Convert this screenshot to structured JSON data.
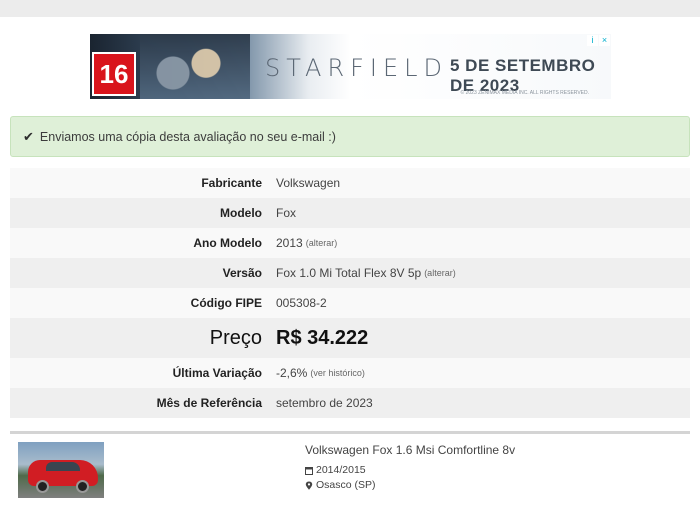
{
  "ad": {
    "rating": "16",
    "logo": "STARFIELD",
    "date": "5 DE SETEMBRO DE 2023",
    "copyright": "© 2023 ZENIMAX MEDIA INC. ALL RIGHTS RESERVED.",
    "info_icon": "i",
    "close_icon": "×"
  },
  "alert": {
    "message": "Enviamos uma cópia desta avaliação no seu e-mail :)"
  },
  "details": {
    "fabricante": {
      "label": "Fabricante",
      "value": "Volkswagen"
    },
    "modelo": {
      "label": "Modelo",
      "value": "Fox"
    },
    "ano_modelo": {
      "label": "Ano Modelo",
      "value": "2013",
      "action": "(alterar)"
    },
    "versao": {
      "label": "Versão",
      "value": "Fox 1.0 Mi Total Flex 8V 5p",
      "action": "(alterar)"
    },
    "codigo_fipe": {
      "label": "Código FIPE",
      "value": "005308-2"
    },
    "preco": {
      "label": "Preço",
      "value": "R$ 34.222"
    },
    "ultima_variacao": {
      "label": "Última Variação",
      "value": "-2,6%",
      "action": "(ver histórico)"
    },
    "mes_referencia": {
      "label": "Mês de Referência",
      "value": "setembro de 2023"
    }
  },
  "listing": {
    "title": "Volkswagen Fox 1.6 Msi Comfortline 8v",
    "year": "2014/2015",
    "location": "Osasco (SP)"
  },
  "colors": {
    "alert_bg": "#dff0d8",
    "rating_red": "#d9141c",
    "car_red": "#d11d23"
  }
}
